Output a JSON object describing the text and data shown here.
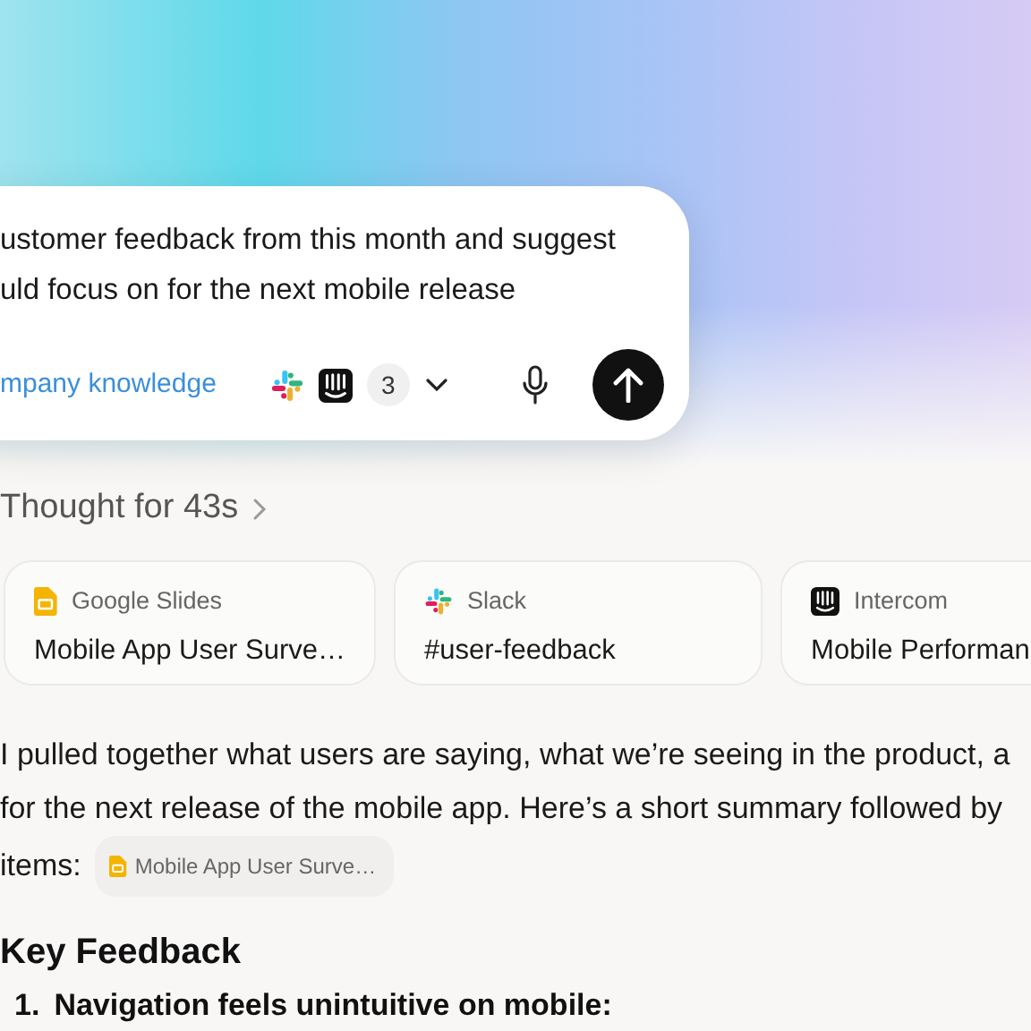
{
  "composer": {
    "prompt_lines": [
      "ustomer feedback from this month and suggest",
      "uld focus on for the next mobile release"
    ],
    "source_label": "mpany knowledge",
    "connectors": [
      {
        "kind": "slack"
      },
      {
        "kind": "intercom"
      }
    ],
    "more_count": "3"
  },
  "thought": {
    "label": "Thought for 43s"
  },
  "sources": [
    {
      "kind": "slides",
      "app": "Google Slides",
      "title": "Mobile App User Surve…"
    },
    {
      "kind": "slack",
      "app": "Slack",
      "title": "#user-feedback"
    },
    {
      "kind": "intercom",
      "app": "Intercom",
      "title": "Mobile Performan"
    }
  ],
  "answer": {
    "lines": [
      "I pulled together what users are saying, what we’re seeing in the product, a",
      "for the next release of the mobile app. Here’s a short summary followed by"
    ],
    "lead_in": "items:",
    "chip": {
      "kind": "slides",
      "label": "Mobile App User Surve…"
    },
    "heading": "Key Feedback",
    "list": [
      {
        "number": "1.",
        "text": "Navigation feels unintuitive on mobile:"
      }
    ]
  }
}
